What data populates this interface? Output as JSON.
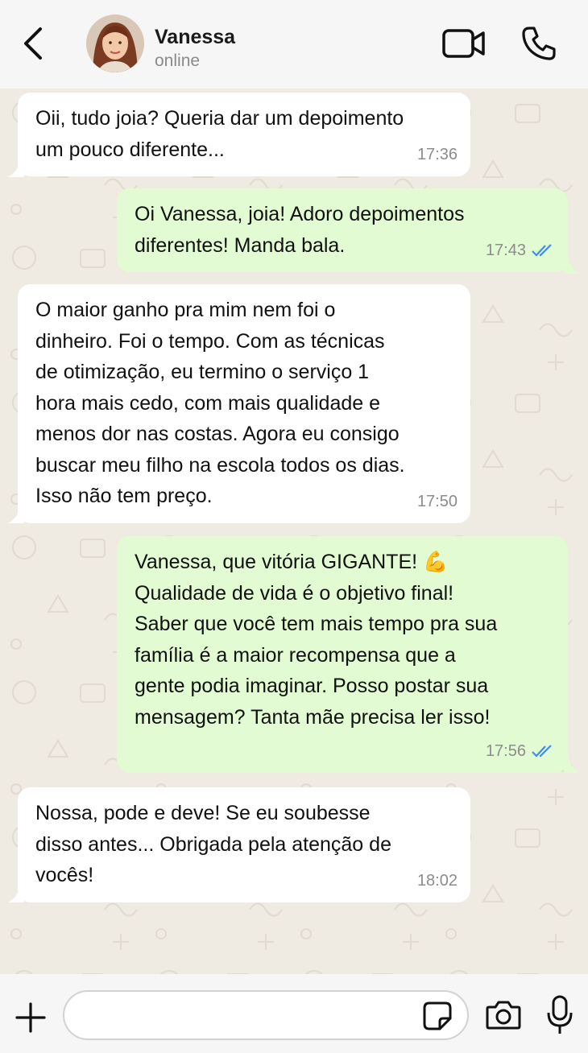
{
  "header": {
    "contact_name": "Vanessa",
    "status": "online",
    "icons": [
      "back-arrow-icon",
      "video-call-icon",
      "phone-icon"
    ]
  },
  "messages": [
    {
      "direction": "incoming",
      "text": "Oii, tudo joia? Queria dar um depoimento\num pouco diferente...",
      "time": "17:36"
    },
    {
      "direction": "outgoing",
      "text": "Oi Vanessa, joia! Adoro depoimentos\ndiferentes! Manda bala.",
      "time": "17:43",
      "status": "read"
    },
    {
      "direction": "incoming",
      "text": "O maior ganho pra mim nem foi o\ndinheiro. Foi o tempo. Com as técnicas\nde otimização, eu termino o serviço 1\nhora mais cedo, com mais qualidade e\nmenos dor nas costas. Agora eu consigo\nbuscar meu filho na escola todos os dias.\nIsso não tem preço.",
      "time": "17:50"
    },
    {
      "direction": "outgoing",
      "text": "Vanessa, que vitória GIGANTE! 💪\nQualidade de vida é o objetivo final!\nSaber que você tem mais tempo pra sua\nfamília é a maior recompensa que a\ngente podia imaginar. Posso postar sua\nmensagem? Tanta mãe precisa ler isso!",
      "time": "17:56",
      "status": "read"
    },
    {
      "direction": "incoming",
      "text": "Nossa, pode e deve! Se eu soubesse\ndisso antes... Obrigada pela atenção de\nvocês!",
      "time": "18:02"
    }
  ],
  "footer": {
    "input_value": "",
    "icons": [
      "plus-icon",
      "sticker-icon",
      "camera-icon",
      "microphone-icon"
    ]
  },
  "colors": {
    "incoming_bubble": "#ffffff",
    "outgoing_bubble": "#e2fbd2",
    "read_ticks": "#3f8fe8",
    "chat_background": "#efeae2",
    "header_background": "#f6f6f6"
  }
}
